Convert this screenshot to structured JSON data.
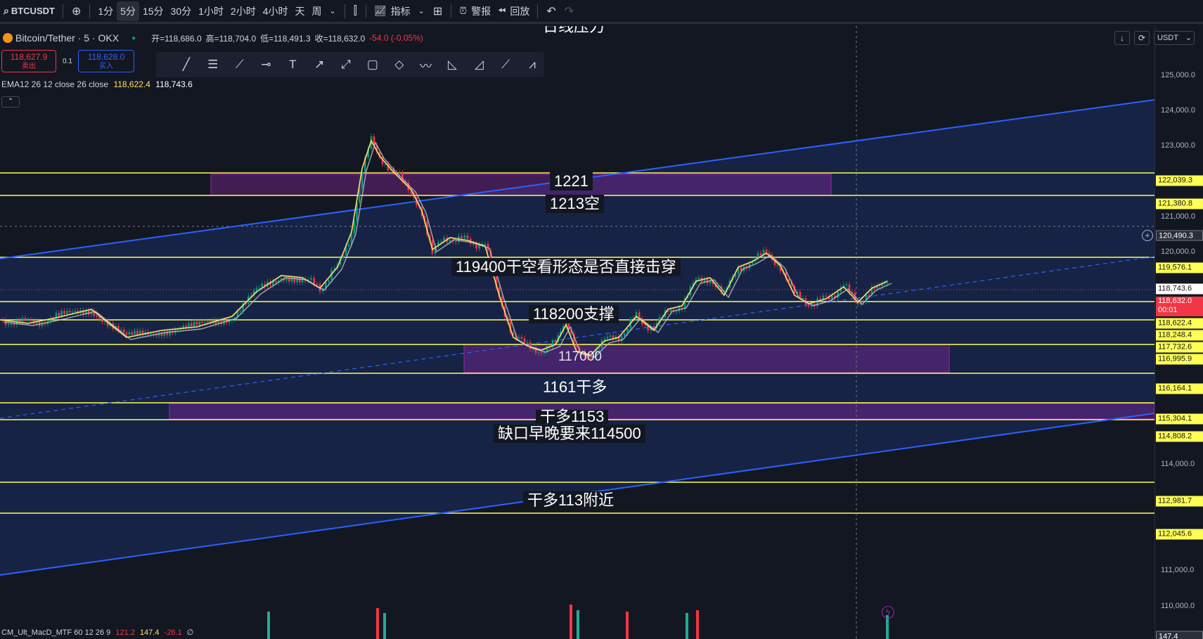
{
  "toolbar": {
    "symbol": "BTCUSDT",
    "intervals": [
      "1分",
      "5分",
      "15分",
      "30分",
      "1小时",
      "2小时",
      "4小时",
      "天",
      "周"
    ],
    "active_interval": "5分",
    "indicators_label": "指标",
    "alerts_label": "警报",
    "replay_label": "回放"
  },
  "legend": {
    "symbol_desc": "Bitcoin/Tether · 5 · OKX",
    "open": "开=118,686.0",
    "high": "高=118,704.0",
    "low": "低=118,491.3",
    "close": "收=118,632.0",
    "change": "-54.0 (-0.05%)",
    "sell_price": "118,627.9",
    "sell_label": "卖出",
    "spread": "0.1",
    "buy_price": "118,628.0",
    "buy_label": "买入",
    "ema_label": "EMA12 26 12 close 26 close",
    "ema1": "118,622.4",
    "ema2": "118,743.6",
    "macd_label": "CM_Ult_MacD_MTF 60 12 26 9",
    "macd_v1": "121.2",
    "macd_v2": "147.4",
    "macd_v3": "-26.1",
    "macd_v4": "∅"
  },
  "axis": {
    "currency": "USDT",
    "ticks": [
      "125,000.0",
      "124,000.0",
      "123,000.0",
      "121,000.0",
      "120,000.0",
      "114,000.0",
      "111,000.0",
      "110,000.0"
    ],
    "tags": {
      "t122039": "122,039.3",
      "t121380": "121,380.8",
      "t120490": "120,490.3",
      "t119576": "119,576.1",
      "t118743": "118,743.6",
      "t118632": "118,632.0",
      "t_countdown": "00:01",
      "t118622": "118,622.4",
      "t118248": "118,248.4",
      "t117732": "117,732.6",
      "t116995": "116,995.9",
      "t116164": "116,164.1",
      "t115304": "115,304.1",
      "t114808": "114,808.2",
      "t112981": "112,981.7",
      "t112045": "112,045.6",
      "t_bottom": "147.4"
    }
  },
  "annotations": {
    "top_title": "日线压力",
    "l1221": "1221",
    "l1213": "1213空",
    "l119400": "119400干空看形态是否直接击穿",
    "l118200": "118200支撑",
    "l117000": "117000",
    "l1161": "1161干多",
    "l1153": "干多1153",
    "l114500": "缺口早晚要来114500",
    "l113": "干多113附近"
  },
  "colors": {
    "background": "#131722",
    "level_line": "#ffff55",
    "channel": "#2962ff",
    "zone": "#9c27b0",
    "up_candle": "#089981",
    "down_candle": "#f23645",
    "ema_fast": "#ffe066",
    "ema_slow": "#c8c8c8"
  },
  "icons": [
    "search-icon",
    "add-icon",
    "chevron-down-icon",
    "candles-icon",
    "indicator-icon",
    "layout-icon",
    "alert-icon",
    "replay-icon",
    "undo-icon",
    "redo-icon",
    "bolt-icon"
  ]
}
